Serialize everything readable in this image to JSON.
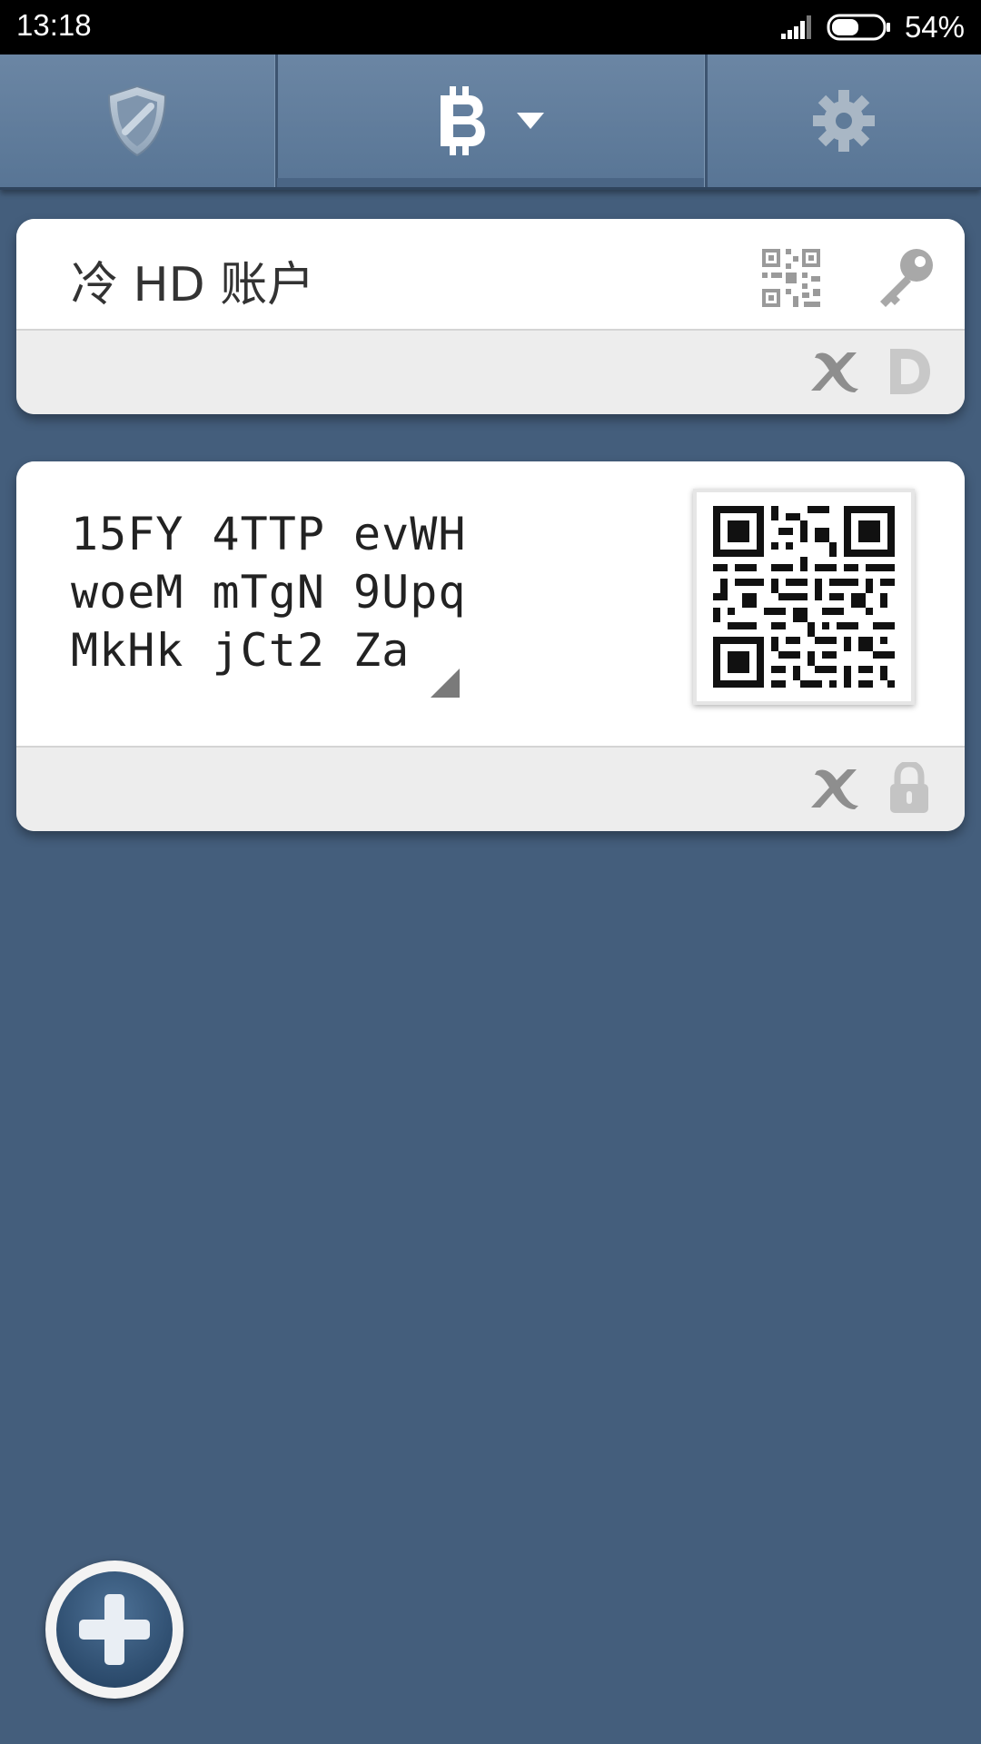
{
  "status_bar": {
    "time": "13:18",
    "battery_percent": "54%",
    "battery_level": 0.54,
    "icons": [
      "signal-icon",
      "battery-icon"
    ]
  },
  "top_nav": {
    "tabs": [
      {
        "name": "security",
        "icon": "shield-icon",
        "selected": false
      },
      {
        "name": "bitcoin",
        "icon": "bitcoin-icon",
        "has_dropdown": true,
        "selected": true
      },
      {
        "name": "settings",
        "icon": "gear-icon",
        "selected": false
      }
    ]
  },
  "hd_account": {
    "title": "冷 HD 账户",
    "icons": [
      "qr-code-icon",
      "key-icon",
      "xrandom-x-icon",
      "d-icon"
    ]
  },
  "address_card": {
    "address_lines": [
      "15FY 4TTP evWH",
      "woeM mTgN 9Upq",
      "MkHk jCt2 Za"
    ],
    "icons": [
      "qr-code",
      "xrandom-x-icon",
      "lock-icon"
    ]
  },
  "fab": {
    "icon": "plus-icon"
  },
  "colors": {
    "background": "#445e7c",
    "nav": "#587595",
    "card": "#ffffff",
    "card_footer": "#ededed"
  }
}
